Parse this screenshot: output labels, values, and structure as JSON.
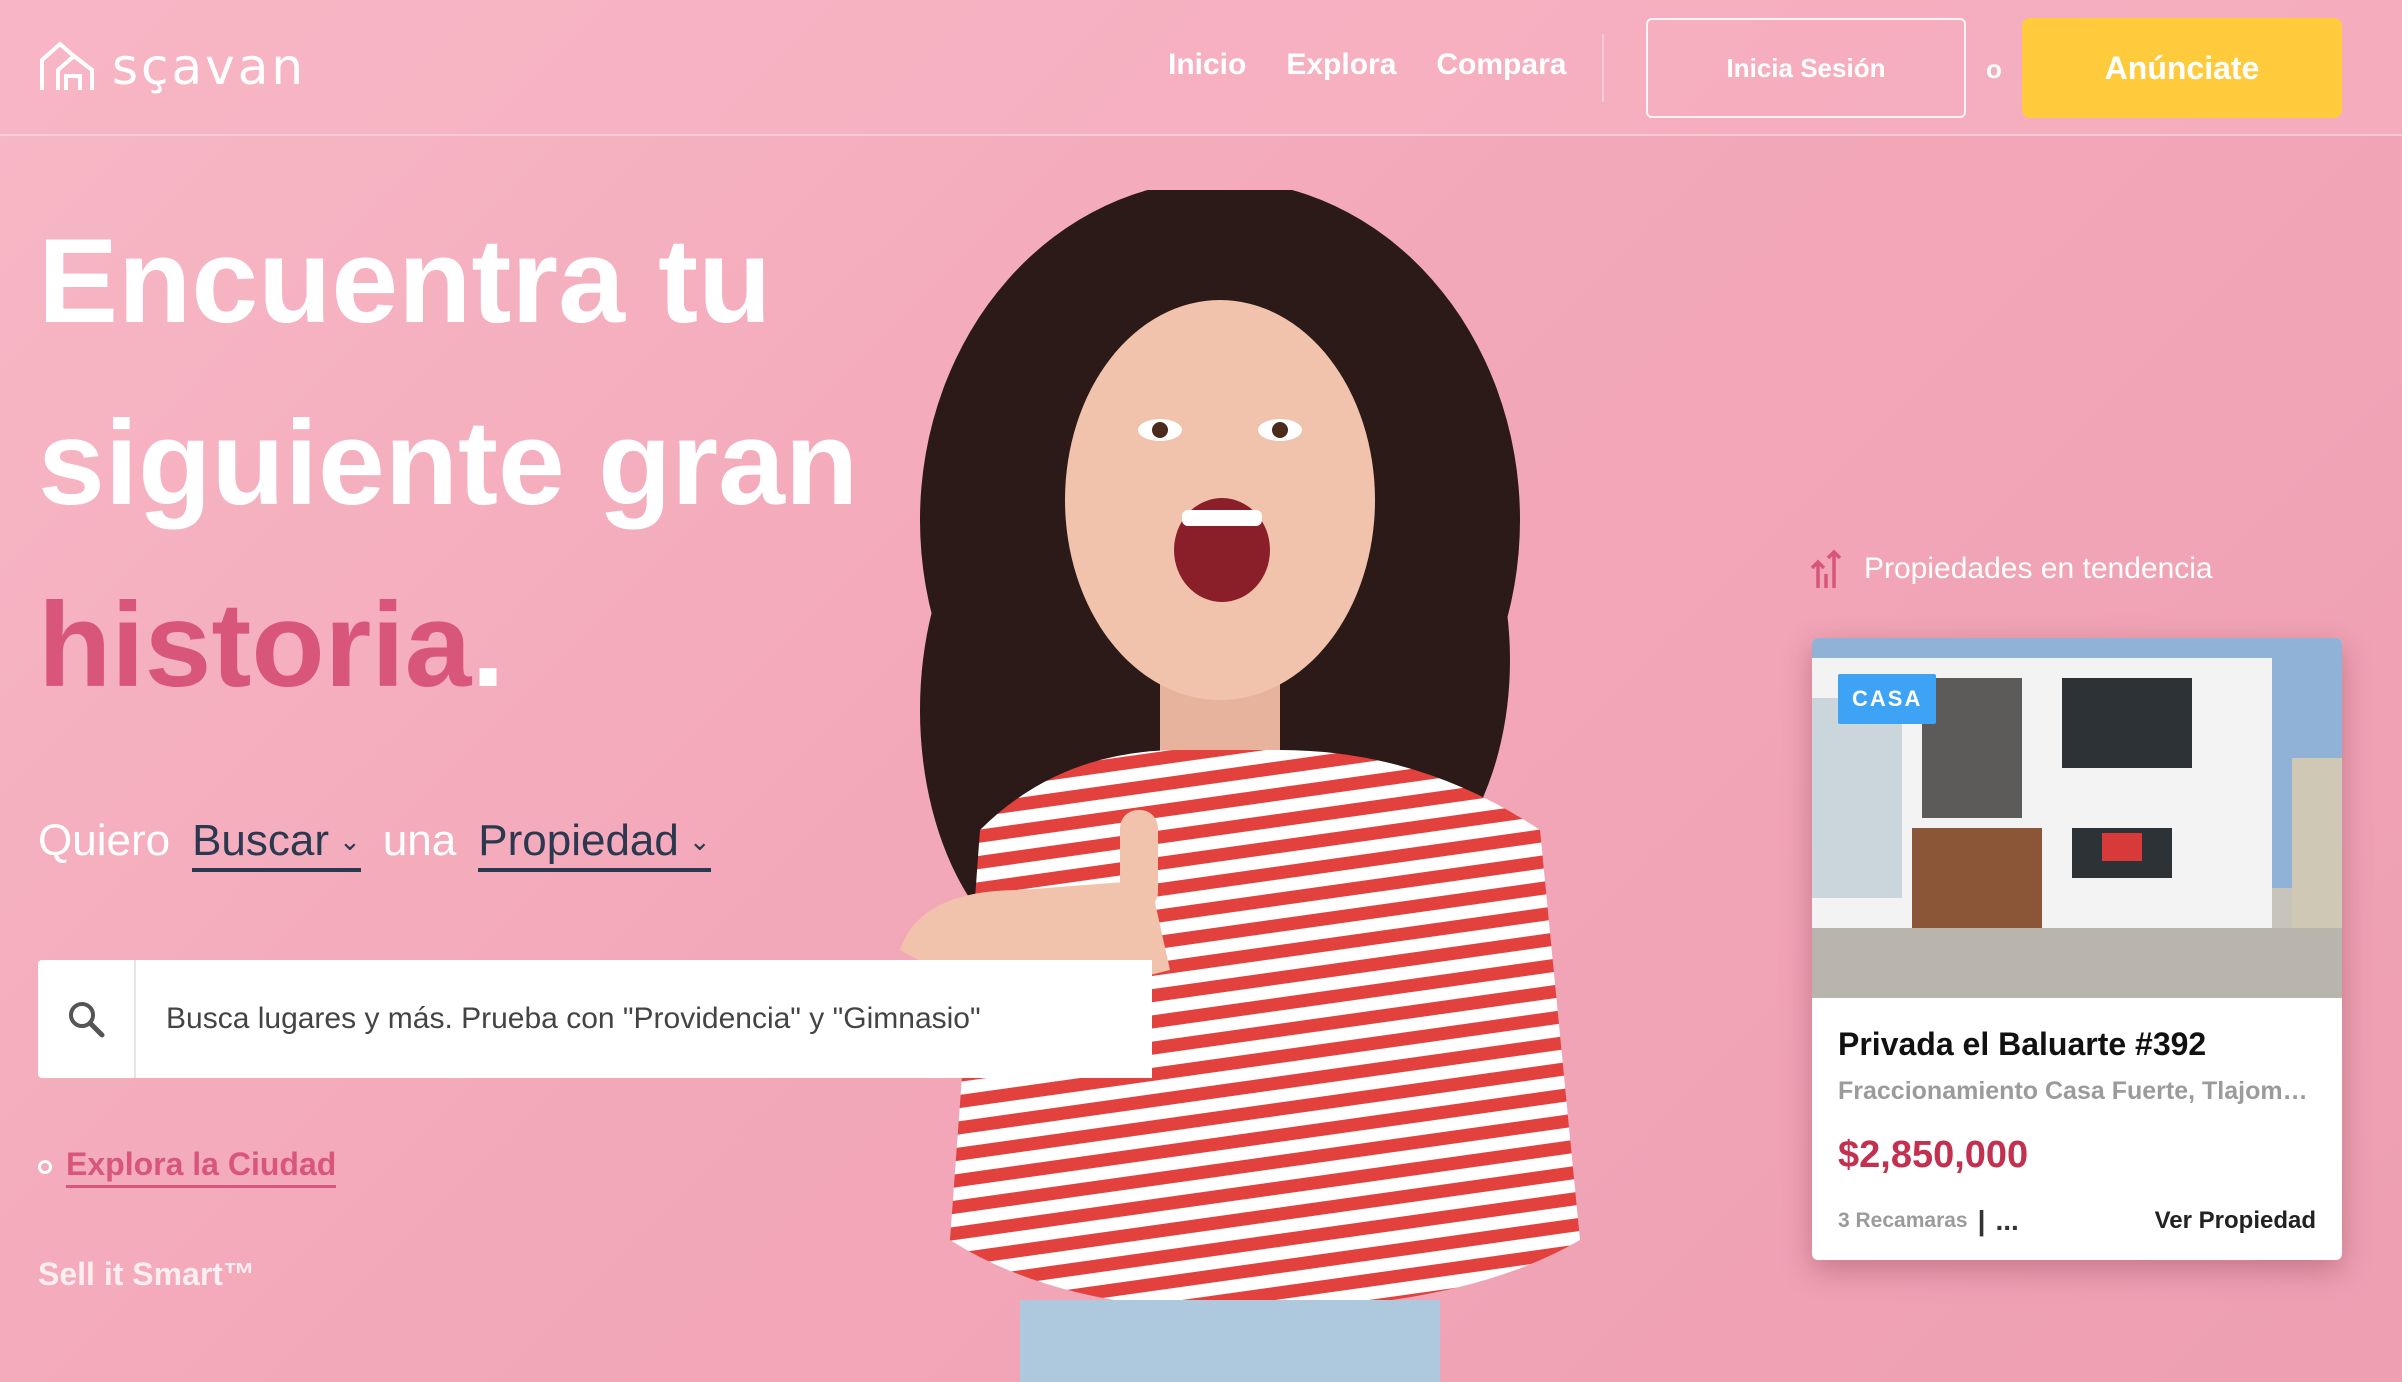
{
  "brand": {
    "name": "sçavan"
  },
  "nav": {
    "items": [
      "Inicio",
      "Explora",
      "Compara"
    ]
  },
  "header": {
    "login_label": "Inicia Sesión",
    "or_text": "o",
    "cta_label": "Anúnciate"
  },
  "hero": {
    "title_line1": "Encuentra tu",
    "title_line2": "siguiente gran",
    "title_accent": "historia",
    "title_period": "."
  },
  "intent": {
    "prefix": "Quiero",
    "action_value": "Buscar",
    "connector": "una",
    "object_value": "Propiedad"
  },
  "search": {
    "placeholder": "Busca lugares y más. Prueba con \"Providencia\" y \"Gimnasio\""
  },
  "explore_link": "Explora la Ciudad",
  "sell_smart": "Sell it Smart™",
  "trending": {
    "heading": "Propiedades en tendencia",
    "card": {
      "badge": "CASA",
      "title": "Privada el Baluarte #392",
      "subtitle": "Fraccionamiento Casa Fuerte, Tlajomulco",
      "price": "$2,850,000",
      "feature": "3 Recamaras",
      "more": "...",
      "cta": "Ver Propiedad"
    }
  },
  "colors": {
    "accent": "#d9567b",
    "cta": "#ffcb3d",
    "badge": "#3ea2f5",
    "price": "#c2314f"
  },
  "icons": [
    "logo-icon",
    "search-icon",
    "chevron-down-icon",
    "trending-icon"
  ]
}
